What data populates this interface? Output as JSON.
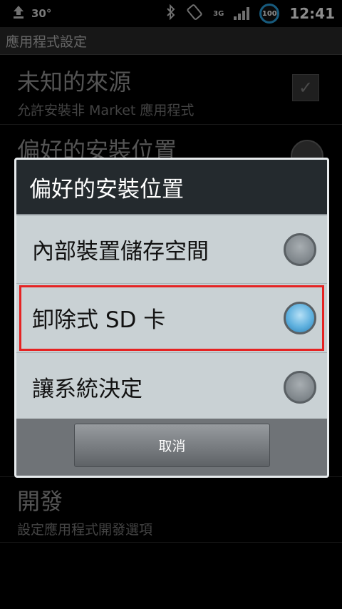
{
  "status_bar": {
    "temperature": "30°",
    "network": "3G",
    "battery": "100",
    "time": "12:41"
  },
  "title_bar": {
    "title": "應用程式設定"
  },
  "settings": {
    "unknown_sources_title": "未知的來源",
    "unknown_sources_summary": "允許安裝非 Market 應用程式",
    "install_location_title": "偏好的安裝位置",
    "development_title": "開發",
    "development_summary": "設定應用程式開發選項"
  },
  "dialog": {
    "title": "偏好的安裝位置",
    "options": [
      {
        "label": "內部裝置儲存空間",
        "selected": false
      },
      {
        "label": "卸除式 SD 卡",
        "selected": true
      },
      {
        "label": "讓系統決定",
        "selected": false
      }
    ],
    "cancel_label": "取消"
  }
}
